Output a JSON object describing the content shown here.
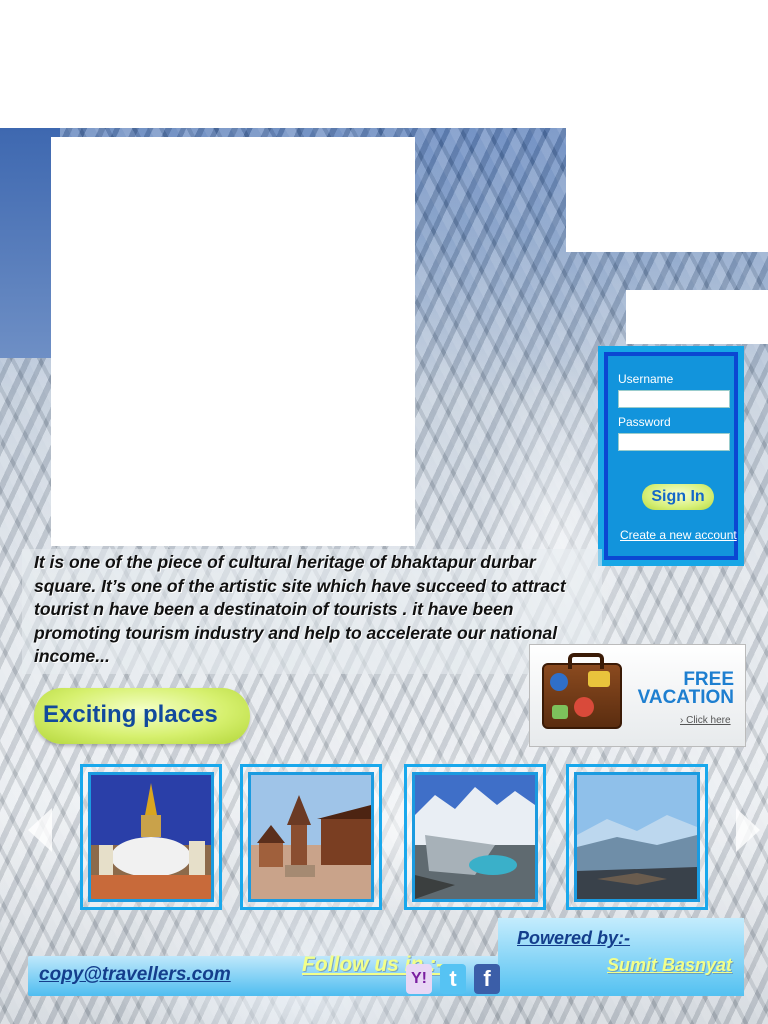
{
  "login": {
    "username_label": "Username",
    "username_value": "",
    "password_label": "Password",
    "password_value": "",
    "signin_label": "Sign In",
    "create_account_label": "Create a new account"
  },
  "description": {
    "text": "It is one of the piece of cultural heritage of bhaktapur durbar square. It’s one of the artistic  site which have succeed to attract tourist n have been a destinatoin of tourists . it have been promoting tourism industry and help to accelerate our national income..."
  },
  "ad": {
    "title_line1": "FREE",
    "title_line2": "VACATION",
    "link_label": "› Click here"
  },
  "places": {
    "heading": "Exciting places",
    "photos": [
      {
        "icon": "stupa-photo"
      },
      {
        "icon": "temple-square-photo"
      },
      {
        "icon": "glacier-lake-photo"
      },
      {
        "icon": "mountain-view-photo"
      }
    ]
  },
  "footer": {
    "email": "copy@travellers.com",
    "follow_label": "Follow us in :-",
    "social": [
      "yahoo-icon",
      "twitter-icon",
      "facebook-icon"
    ],
    "powered_label": "Powered by:-",
    "author": "Sumit Basnyat"
  },
  "colors": {
    "accent_blue": "#17a6e6",
    "login_border": "#0b47d2",
    "button_green": "#d7f07a",
    "heading_blue": "#124a9c",
    "footer_yellow": "#f2ff8a"
  }
}
